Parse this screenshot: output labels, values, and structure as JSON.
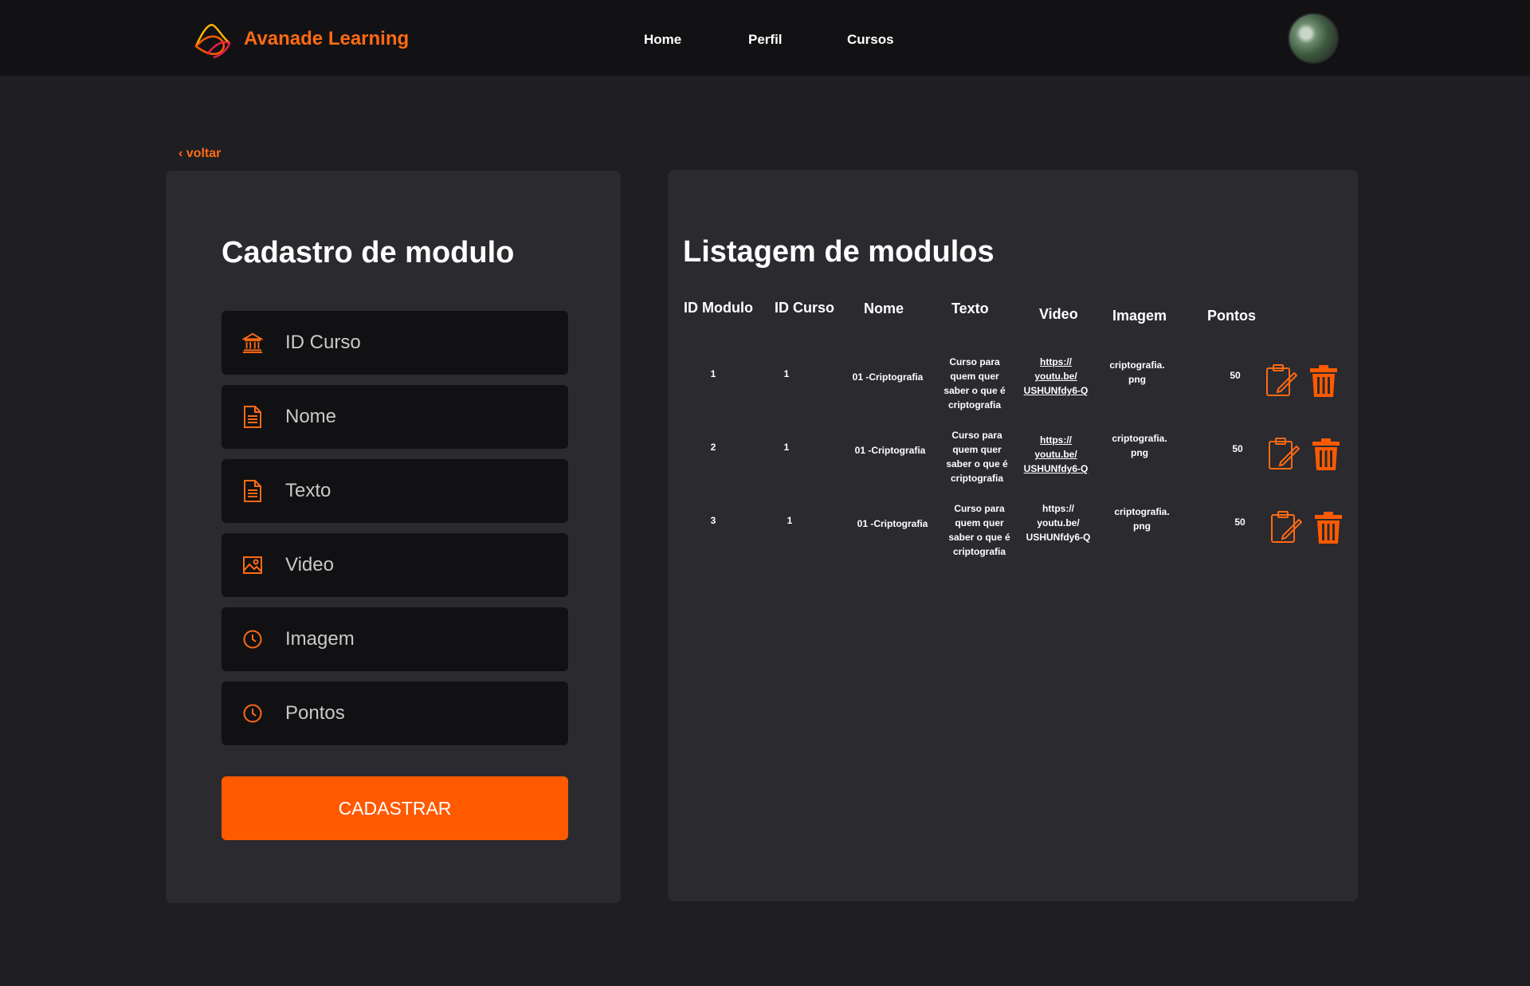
{
  "header": {
    "brand": "Avanade Learning",
    "nav": [
      "Home",
      "Perfil",
      "Cursos"
    ],
    "accent_color": "#ff6a13"
  },
  "back_label": "‹ voltar",
  "form": {
    "title": "Cadastro de modulo",
    "fields": [
      {
        "placeholder": "ID Curso",
        "icon": "institution-icon",
        "value": ""
      },
      {
        "placeholder": "Nome",
        "icon": "document-icon",
        "value": ""
      },
      {
        "placeholder": "Texto",
        "icon": "document-icon",
        "value": ""
      },
      {
        "placeholder": "Video",
        "icon": "image-icon",
        "value": ""
      },
      {
        "placeholder": "Imagem",
        "icon": "clock-icon",
        "value": ""
      },
      {
        "placeholder": "Pontos",
        "icon": "clock-icon",
        "value": ""
      }
    ],
    "submit_label": "CADASTRAR",
    "submit_color": "#ff5a00"
  },
  "list": {
    "title": "Listagem de modulos",
    "columns": [
      "ID Modulo",
      "ID Curso",
      "Nome",
      "Texto",
      "Video",
      "Imagem",
      "Pontos"
    ],
    "rows": [
      {
        "id_modulo": "1",
        "id_curso": "1",
        "nome": "01 -Criptografia",
        "texto": "Curso para quem quer saber o que é criptografia",
        "video": "https:// youtu.be/ USHUNfdy6-Q",
        "imagem": "criptografia. png",
        "pontos": "50"
      },
      {
        "id_modulo": "2",
        "id_curso": "1",
        "nome": "01 -Criptografia",
        "texto": "Curso para quem quer saber o que é criptografia",
        "video": "https:// youtu.be/ USHUNfdy6-Q",
        "imagem": "criptografia. png",
        "pontos": "50"
      },
      {
        "id_modulo": "3",
        "id_curso": "1",
        "nome": "01 -Criptografia",
        "texto": "Curso para quem quer saber o que é criptografia",
        "video": "https:// youtu.be/ USHUNfdy6-Q",
        "imagem": "criptografia. png",
        "pontos": "50"
      }
    ],
    "row_actions": [
      "edit-icon",
      "trash-icon"
    ]
  }
}
